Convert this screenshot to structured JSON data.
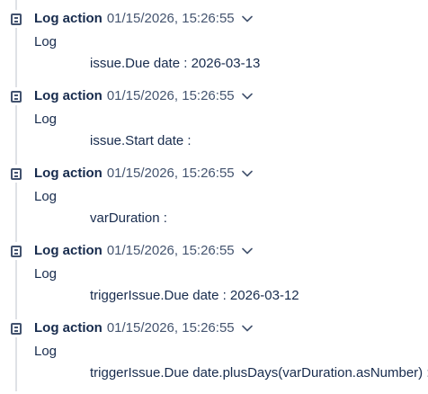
{
  "entries": [
    {
      "title": "Log action",
      "timestamp": "01/15/2026, 15:26:55",
      "label": "Log",
      "message": "issue.Due date : 2026-03-13"
    },
    {
      "title": "Log action",
      "timestamp": "01/15/2026, 15:26:55",
      "label": "Log",
      "message": "issue.Start date :"
    },
    {
      "title": "Log action",
      "timestamp": "01/15/2026, 15:26:55",
      "label": "Log",
      "message": "varDuration :"
    },
    {
      "title": "Log action",
      "timestamp": "01/15/2026, 15:26:55",
      "label": "Log",
      "message": "triggerIssue.Due date : 2026-03-12"
    },
    {
      "title": "Log action",
      "timestamp": "01/15/2026, 15:26:55",
      "label": "Log",
      "message": "triggerIssue.Due date.plusDays(varDuration.asNumber) :"
    }
  ],
  "icons": {
    "entry": "log-document-icon",
    "expand": "chevron-down-icon"
  },
  "colors": {
    "text": "#172b4d",
    "muted": "#44546f",
    "line": "#dfe1e6",
    "icon": "#42526e"
  }
}
